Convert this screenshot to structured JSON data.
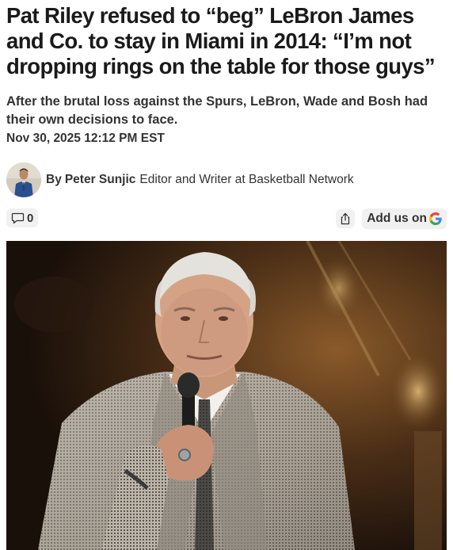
{
  "article": {
    "headline": "Pat Riley refused to “beg” LeBron James and Co. to stay in Miami in 2014: “I’m not dropping rings on the table for those guys”",
    "subtitle": "After the brutal loss against the Spurs, LeBron, Wade and Bosh had their own decisions to face.",
    "dateline": "Nov 30, 2025 12:12 PM EST"
  },
  "author": {
    "by_label": "By",
    "name": "Peter Sunjic",
    "role": "Editor and Writer at Basketball Network",
    "avatar_icon": "author-avatar"
  },
  "actions": {
    "comments_icon": "comment-bubble-icon",
    "comments_count": "0",
    "share_icon": "share-icon",
    "google_label": "Add us on",
    "google_icon": "google-g-icon"
  },
  "hero_image": {
    "description_icon": "article-hero-photo"
  },
  "colors": {
    "text": "#1a1a1a",
    "secondary_text": "#333333",
    "button_bg": "#f1f1f1",
    "google_blue": "#4285F4",
    "google_red": "#EA4335",
    "google_yellow": "#FBBC05",
    "google_green": "#34A853"
  }
}
